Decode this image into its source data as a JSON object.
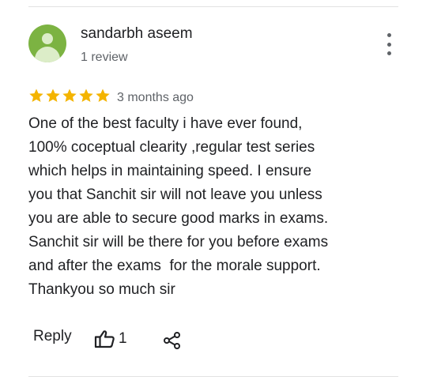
{
  "reviewer": {
    "name": "sandarbh aseem",
    "review_count": "1 review",
    "avatar": "person-icon",
    "avatar_color": "#7cb342"
  },
  "review": {
    "rating": 5,
    "max_rating": 5,
    "star_color": "#f4b400",
    "date": "3 months ago",
    "lines": [
      "One of the best faculty i have ever found,",
      "100% coceptual clearity ,regular test series",
      "which helps in maintaining speed. I ensure",
      "you that Sanchit sir will not leave you unless",
      "you are able to secure good marks in exams.",
      "Sanchit sir will be there for you before exams",
      "and after the exams  for the morale support.",
      "Thankyou so much sir"
    ]
  },
  "actions": {
    "reply_label": "Reply",
    "like_count": "1",
    "like_icon": "thumbs-up-icon",
    "share_icon": "share-icon",
    "menu_icon": "more-vert-icon"
  }
}
